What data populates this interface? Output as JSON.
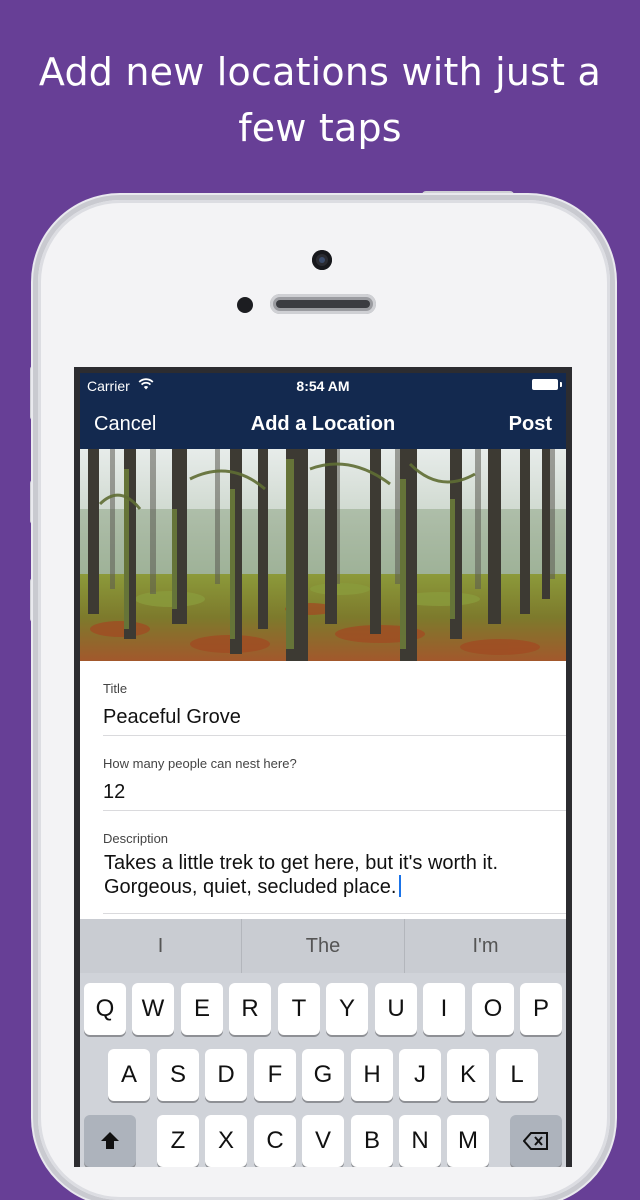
{
  "headline": {
    "line1": "Add new locations with just a",
    "line2": "few taps"
  },
  "status_bar": {
    "carrier": "Carrier",
    "time": "8:54 AM"
  },
  "nav": {
    "cancel": "Cancel",
    "title": "Add a Location",
    "post": "Post"
  },
  "form": {
    "title_label": "Title",
    "title_value": "Peaceful Grove",
    "capacity_label": "How many people can nest here?",
    "capacity_value": "12",
    "description_label": "Description",
    "description_line1": "Takes a little trek to get here, but it's worth it.",
    "description_line2": "Gorgeous, quiet, secluded place."
  },
  "keyboard": {
    "suggestions": [
      "I",
      "The",
      "I'm"
    ],
    "row1": [
      "Q",
      "W",
      "E",
      "R",
      "T",
      "Y",
      "U",
      "I",
      "O",
      "P"
    ],
    "row2": [
      "A",
      "S",
      "D",
      "F",
      "G",
      "H",
      "J",
      "K",
      "L"
    ],
    "row3": [
      "Z",
      "X",
      "C",
      "V",
      "B",
      "N",
      "M"
    ]
  },
  "colors": {
    "background": "#673f96",
    "navbar": "#13294f",
    "caret": "#1a73e8"
  }
}
